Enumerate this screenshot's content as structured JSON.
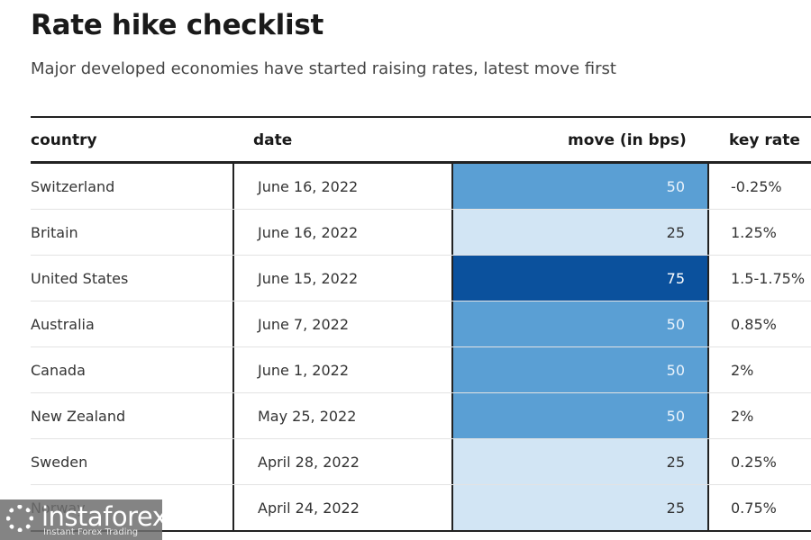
{
  "chart_data": {
    "type": "table",
    "title": "Rate hike checklist",
    "subtitle": "Major developed economies have started raising rates, latest move first",
    "columns": [
      "country",
      "date",
      "move (in bps)",
      "key rate"
    ],
    "rows": [
      {
        "country": "Switzerland",
        "date": "June 16, 2022",
        "move": 50,
        "move_label": "50",
        "key_rate": "-0.25%"
      },
      {
        "country": "Britain",
        "date": "June 16, 2022",
        "move": 25,
        "move_label": "25",
        "key_rate": "1.25%"
      },
      {
        "country": "United States",
        "date": "June 15, 2022",
        "move": 75,
        "move_label": "75",
        "key_rate": "1.5-1.75%"
      },
      {
        "country": "Australia",
        "date": "June 7, 2022",
        "move": 50,
        "move_label": "50",
        "key_rate": "0.85%"
      },
      {
        "country": "Canada",
        "date": "June 1, 2022",
        "move": 50,
        "move_label": "50",
        "key_rate": "2%"
      },
      {
        "country": "New Zealand",
        "date": "May 25, 2022",
        "move": 50,
        "move_label": "50",
        "key_rate": "2%"
      },
      {
        "country": "Sweden",
        "date": "April 28, 2022",
        "move": 25,
        "move_label": "25",
        "key_rate": "0.25%"
      },
      {
        "country": "Norway",
        "date": "April 24, 2022",
        "move": 25,
        "move_label": "25",
        "key_rate": "0.75%"
      }
    ],
    "move_colors": {
      "25": "#d2e5f4",
      "50": "#5a9fd4",
      "75": "#0b519d"
    },
    "move_text_colors": {
      "25": "#333333",
      "50": "#eaf3fb",
      "75": "#ffffff"
    }
  },
  "watermark": {
    "logo": "instaforex",
    "tagline": "Instant Forex Trading"
  }
}
